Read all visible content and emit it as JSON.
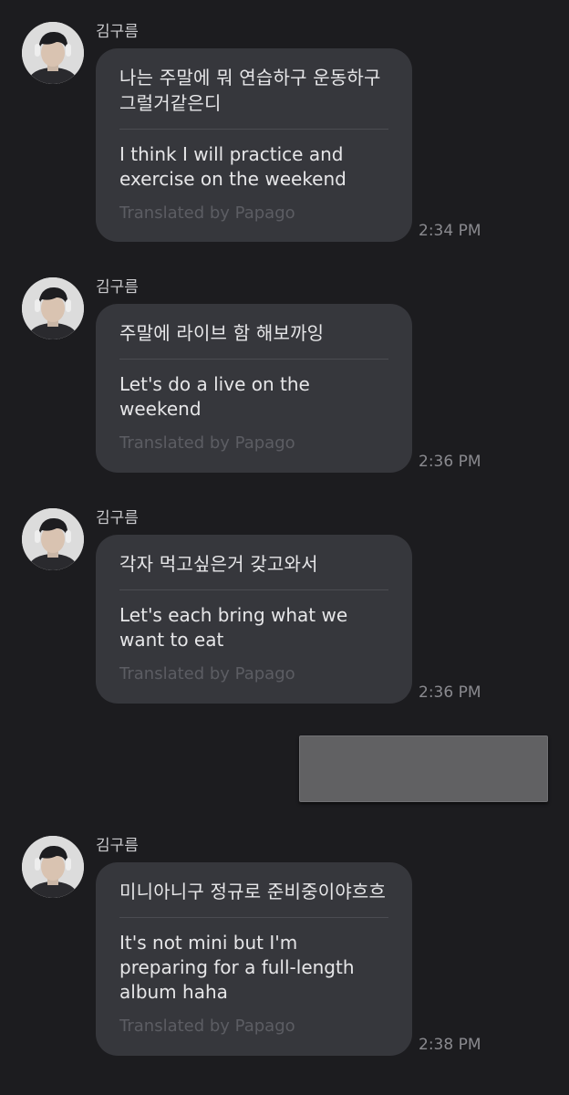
{
  "messages": [
    {
      "sender": "김구름",
      "original": "나는 주말에 뭐 연습하구 운동하구 그럴거같은디",
      "translation": "I think I will practice and exercise on the weekend",
      "translated_by": "Translated by Papago",
      "time": "2:34 PM"
    },
    {
      "sender": "김구름",
      "original": "주말에 라이브 함 해보까잉",
      "translation": "Let's do a live on the weekend",
      "translated_by": "Translated by Papago",
      "time": "2:36 PM"
    },
    {
      "sender": "김구름",
      "original": "각자 먹고싶은거 갖고와서",
      "translation": "Let's each bring what we want to eat",
      "translated_by": "Translated by Papago",
      "time": "2:36 PM"
    },
    {
      "sender": "김구름",
      "original": "미니아니구 정규로 준비중이야흐흐",
      "translation": "It's not mini but I'm preparing for a full-length album haha",
      "translated_by": "Translated by Papago",
      "time": "2:38 PM"
    }
  ],
  "sent_message": {
    "redacted": true,
    "color": "#616163"
  },
  "colors": {
    "background": "#1c1c1f",
    "bubble": "#36373c",
    "text": "#e6e6e8",
    "muted": "#5c5d63",
    "time": "#8a8a8f"
  },
  "icons": {
    "avatar": "profile-photo"
  }
}
